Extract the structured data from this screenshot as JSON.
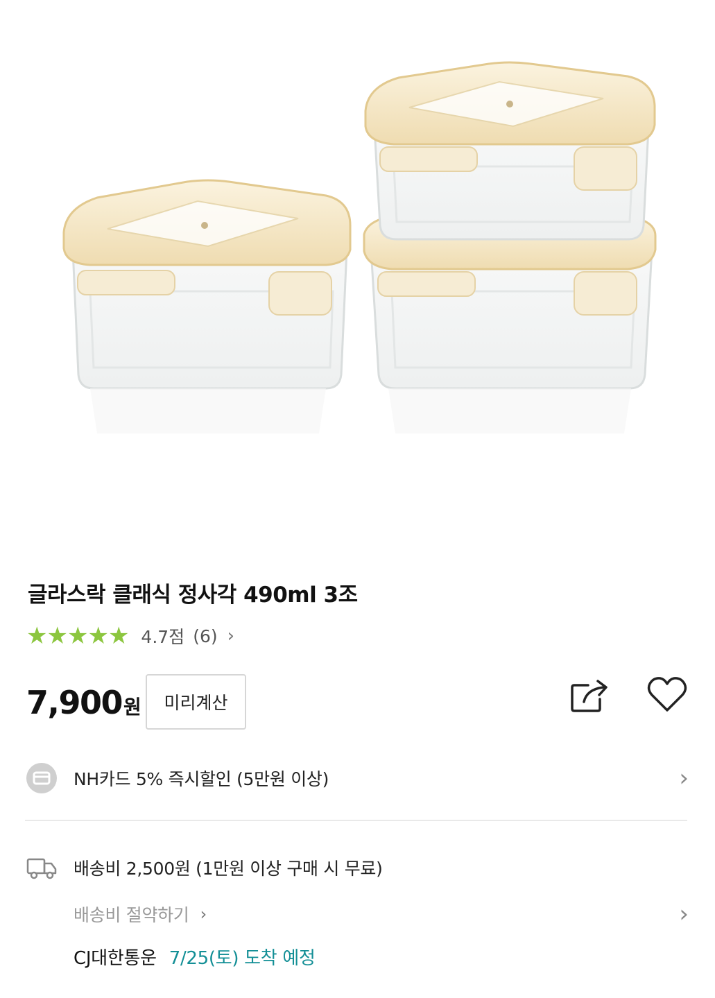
{
  "product": {
    "title": "글라스락 클래식 정사각 490ml 3조",
    "image_alt": "glass containers with beige lids",
    "rating": {
      "stars": [
        "★",
        "★",
        "★",
        "★",
        "★"
      ],
      "value": 4.7,
      "score_label": "4.7점",
      "count_label": "(6)",
      "chevron": "›"
    },
    "price": {
      "amount": "7,900",
      "currency": "원"
    },
    "calc_button_label": "미리계산",
    "share_icon": "share-icon",
    "like_icon": "heart-icon"
  },
  "benefit": {
    "icon": "card-icon",
    "text": "NH카드 5% 즉시할인 (5만원 이상)",
    "chevron": "›"
  },
  "shipping": {
    "icon": "truck-icon",
    "fee_text": "배송비 2,500원 (1만원 이상 구매 시 무료)",
    "save_link": "배송비 절약하기",
    "save_chevron": "›",
    "row_chevron": "›",
    "carrier": "CJ대한통운",
    "arrival": "7/25(토) 도착 예정"
  },
  "colors": {
    "star": "#8cc63f",
    "arrival": "#138f96",
    "lid": "#f3e6c4",
    "lid_edge": "#e6cf9e"
  }
}
